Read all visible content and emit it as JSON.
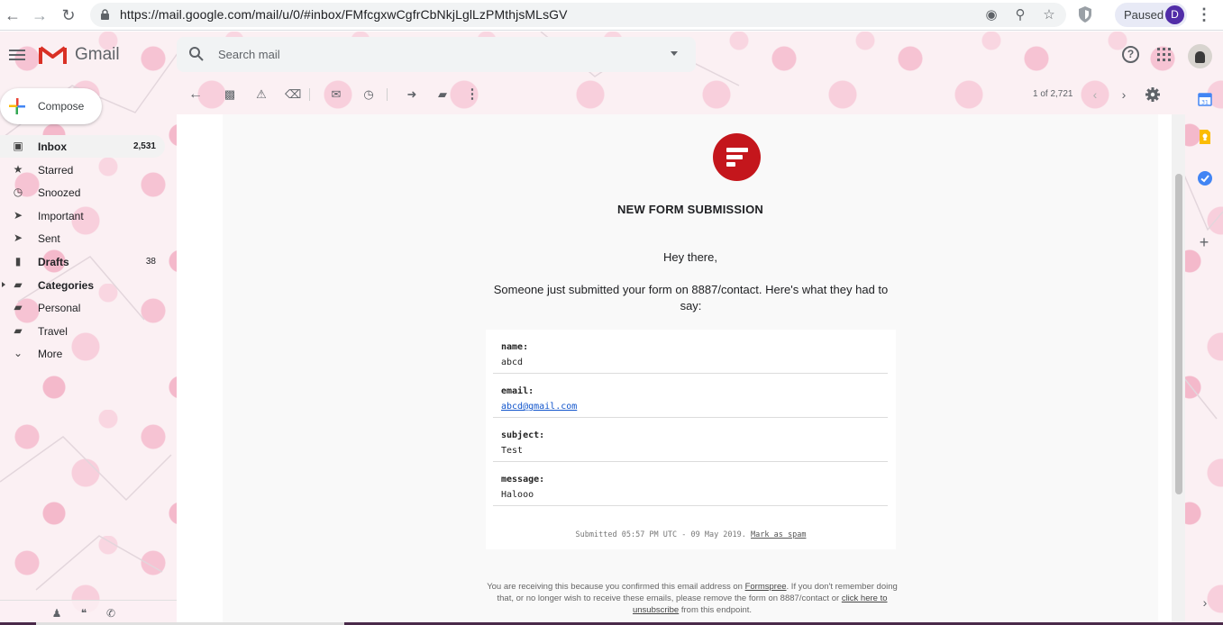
{
  "browser": {
    "url": "https://mail.google.com/mail/u/0/#inbox/FMfcgxwCgfrCbNkjLglLzPMthjsMLsGV",
    "profile_status": "Paused",
    "profile_initial": "D"
  },
  "header": {
    "app_name": "Gmail",
    "search_placeholder": "Search mail"
  },
  "compose_label": "Compose",
  "sidebar": {
    "items": [
      {
        "label": "Inbox",
        "count": "2,531"
      },
      {
        "label": "Starred",
        "count": ""
      },
      {
        "label": "Snoozed",
        "count": ""
      },
      {
        "label": "Important",
        "count": ""
      },
      {
        "label": "Sent",
        "count": ""
      },
      {
        "label": "Drafts",
        "count": "38"
      },
      {
        "label": "Categories",
        "count": ""
      },
      {
        "label": "Personal",
        "count": ""
      },
      {
        "label": "Travel",
        "count": ""
      },
      {
        "label": "More",
        "count": ""
      }
    ]
  },
  "toolbar": {
    "pager": "1 of 2,721"
  },
  "email": {
    "title": "NEW FORM SUBMISSION",
    "greeting": "Hey there,",
    "intro": "Someone just submitted your form on 8887/contact. Here's what they had to say:",
    "fields": [
      {
        "key": "name:",
        "value": "abcd"
      },
      {
        "key": "email:",
        "value": "abcd@gmail.com"
      },
      {
        "key": "subject:",
        "value": "Test"
      },
      {
        "key": "message:",
        "value": "Halooo"
      }
    ],
    "submitted": "Submitted 05:57 PM UTC - 09 May 2019.",
    "mark_spam": "Mark as spam",
    "footer_1": "You are receiving this because you confirmed this email address on ",
    "footer_link_1": "Formspree",
    "footer_2": ". If you don't remember doing that, or no longer wish to receive these emails, please remove the form on 8887/contact or ",
    "footer_link_2": "click here to unsubscribe",
    "footer_3": " from this endpoint."
  },
  "colors": {
    "formspree_red": "#c4161c",
    "link_blue": "#1155cc",
    "profile_purple": "#512da8"
  }
}
